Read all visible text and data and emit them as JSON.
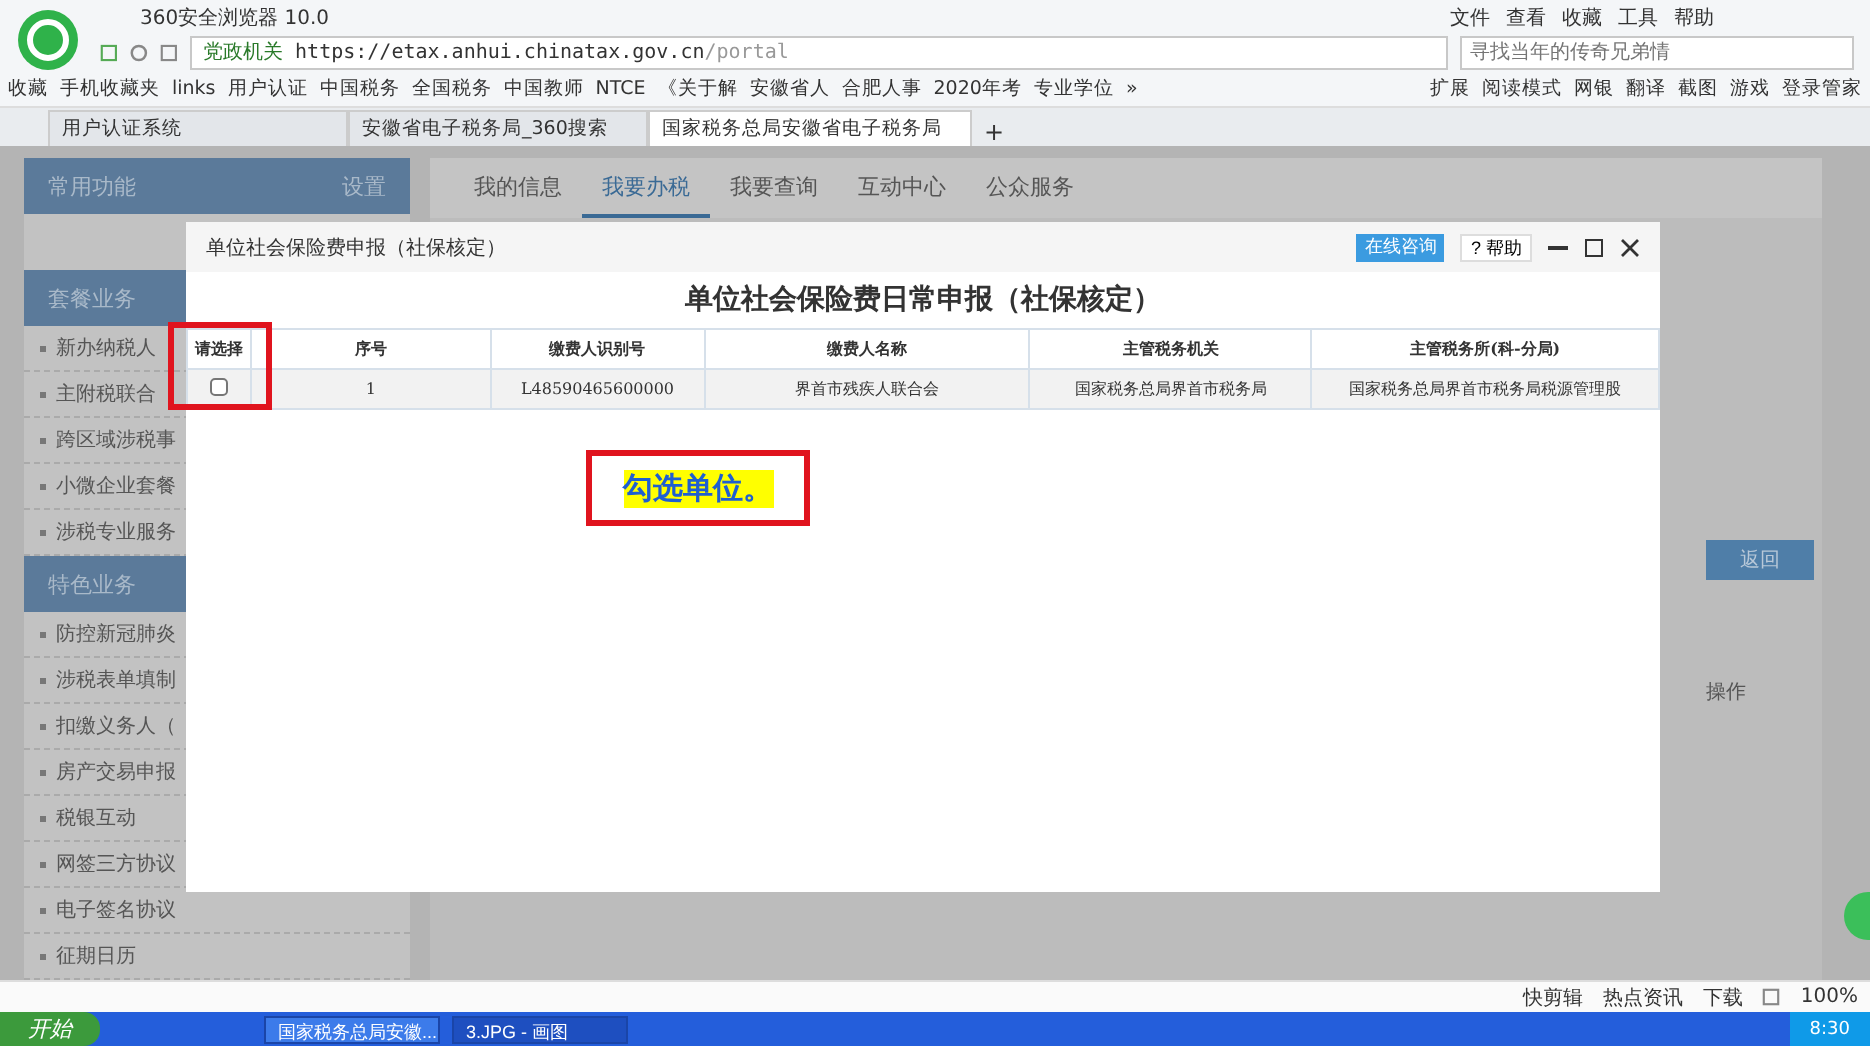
{
  "browser": {
    "title": "360安全浏览器 10.0",
    "menu": [
      "文件",
      "查看",
      "收藏",
      "工具",
      "帮助"
    ],
    "address": {
      "badge": "党政机关",
      "url_host": "https://etax.anhui.chinatax.gov.cn",
      "url_path": "/portal"
    },
    "search": {
      "placeholder": "寻找当年的传奇兄弟情"
    },
    "bookmarks": [
      "收藏",
      "手机收藏夹",
      "links",
      "用户认证",
      "中国税务",
      "全国税务",
      "中国教师",
      "NTCE",
      "《关于解",
      "安徽省人",
      "合肥人事",
      "2020年考",
      "专业学位",
      "»"
    ],
    "tools": [
      "扩展",
      "阅读模式",
      "网银",
      "翻译",
      "截图",
      "游戏",
      "登录管家"
    ],
    "tabs": [
      {
        "label": "用户认证系统",
        "selected": false
      },
      {
        "label": "安徽省电子税务局_360搜索",
        "selected": false
      },
      {
        "label": "国家税务总局安徽省电子税务局",
        "selected": true
      }
    ],
    "new_tab": "+"
  },
  "sidebar": {
    "sections": [
      {
        "title": "常用功能",
        "action": "设置"
      },
      {
        "title": "套餐业务",
        "items": [
          "新办纳税人",
          "主附税联合",
          "跨区域涉税事",
          "小微企业套餐",
          "涉税专业服务"
        ]
      },
      {
        "title": "特色业务",
        "items": [
          "防控新冠肺炎",
          "涉税表单填制",
          "扣缴义务人（",
          "房产交易申报",
          "税银互动",
          "网签三方协议",
          "电子签名协议",
          "征期日历"
        ]
      }
    ]
  },
  "main": {
    "tabs": [
      {
        "label": "我的信息",
        "selected": false
      },
      {
        "label": "我要办税",
        "selected": true
      },
      {
        "label": "我要查询",
        "selected": false
      },
      {
        "label": "互动中心",
        "selected": false
      },
      {
        "label": "公众服务",
        "selected": false
      }
    ],
    "return_button": "返回",
    "column_operation": "操作"
  },
  "modal": {
    "title": "单位社会保险费申报（社保核定）",
    "consult": "在线咨询",
    "help_icon": "?",
    "help": "帮助",
    "heading": "单位社会保险费日常申报（社保核定）",
    "columns": [
      "请选择",
      "序号",
      "缴费人识别号",
      "缴费人名称",
      "主管税务机关",
      "主管税务所(科-分局)"
    ],
    "rows": [
      {
        "checked": false,
        "cells": [
          "",
          "1",
          "L48590465600000",
          "界首市残疾人联合会",
          "国家税务总局界首市税务局",
          "国家税务总局界首市税务局税源管理股"
        ]
      }
    ]
  },
  "callout": {
    "text": "勾选单位。"
  },
  "status_bar": {
    "items": [
      "快剪辑",
      "热点资讯",
      "下载"
    ],
    "zoom": "100%"
  },
  "taskbar": {
    "start": "开始",
    "windows": [
      "国家税务总局安徽...",
      "3.JPG - 画图"
    ],
    "clock": "8:30"
  }
}
